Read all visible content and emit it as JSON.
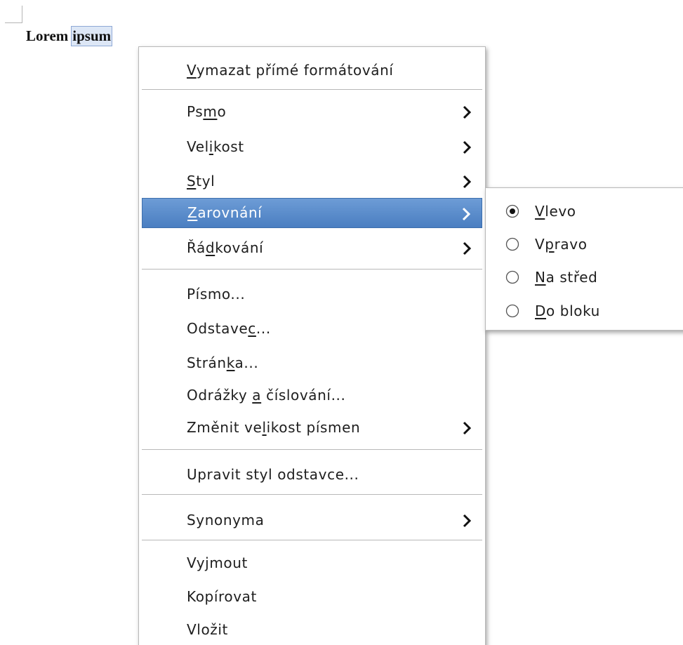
{
  "document": {
    "word_1": "Lorem",
    "word_2_selected": "ipsum"
  },
  "context_menu": {
    "items": [
      {
        "pre": "",
        "acc": "V",
        "post": "ymazat přímé formátování",
        "submenu": false
      },
      {
        "pre": "Ps",
        "acc": "m",
        "post": "o",
        "submenu": true
      },
      {
        "pre": "Vel",
        "acc": "i",
        "post": "kost",
        "submenu": true
      },
      {
        "pre": "",
        "acc": "S",
        "post": "tyl",
        "submenu": true
      },
      {
        "pre": "",
        "acc": "Z",
        "post": "arovnání",
        "submenu": true,
        "highlighted": true
      },
      {
        "pre": "Řá",
        "acc": "d",
        "post": "kování",
        "submenu": true
      },
      {
        "pre": "Písmo...",
        "acc": "",
        "post": "",
        "submenu": false
      },
      {
        "pre": "Odstave",
        "acc": "c",
        "post": "...",
        "submenu": false
      },
      {
        "pre": "Strán",
        "acc": "k",
        "post": "a...",
        "submenu": false
      },
      {
        "pre": "Odrážky ",
        "acc": "a",
        "post": " číslování...",
        "submenu": false
      },
      {
        "pre": "Změnit ve",
        "acc": "l",
        "post": "ikost písmen",
        "submenu": true
      },
      {
        "pre": "Upravit styl odstavce...",
        "acc": "",
        "post": "",
        "submenu": false
      },
      {
        "pre": "Synonyma",
        "acc": "",
        "post": "",
        "submenu": true
      },
      {
        "pre": "Vyjmout",
        "acc": "",
        "post": "",
        "submenu": false
      },
      {
        "pre": "Kopírovat",
        "acc": "",
        "post": "",
        "submenu": false
      },
      {
        "pre": "Vložit",
        "acc": "",
        "post": "",
        "submenu": false
      }
    ]
  },
  "alignment_submenu": {
    "items": [
      {
        "pre": "",
        "acc": "V",
        "post": "levo",
        "checked": true
      },
      {
        "pre": "V",
        "acc": "p",
        "post": "ravo",
        "checked": false
      },
      {
        "pre": "",
        "acc": "N",
        "post": "a střed",
        "checked": false
      },
      {
        "pre": "",
        "acc": "D",
        "post": "o bloku",
        "checked": false
      }
    ]
  },
  "colors": {
    "highlight": "#5a8bcb",
    "selection": "#dde7f6"
  }
}
